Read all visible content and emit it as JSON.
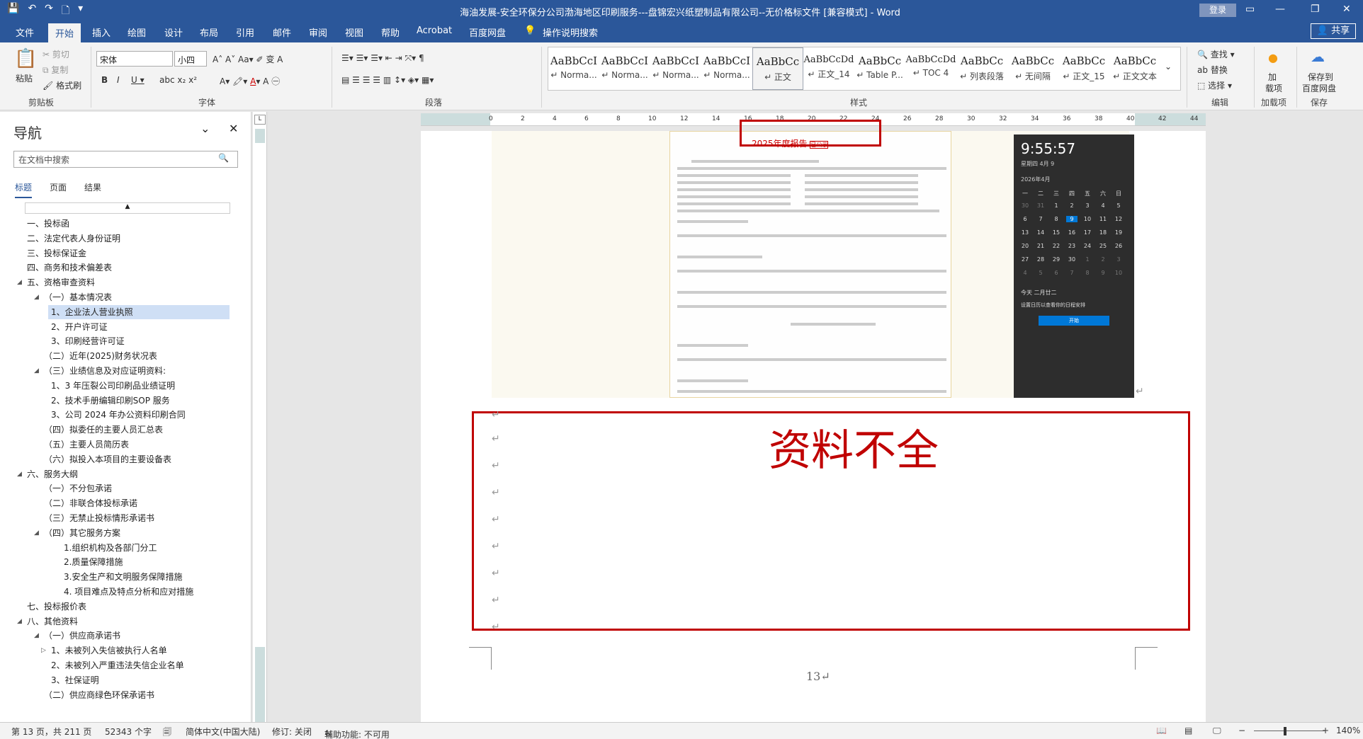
{
  "window": {
    "title": "海油发展-安全环保分公司渤海地区印刷服务---盘锦宏兴纸塑制品有限公司--无价格标文件 [兼容模式]  -  Word",
    "login": "登录"
  },
  "tabs": [
    "文件",
    "开始",
    "插入",
    "绘图",
    "设计",
    "布局",
    "引用",
    "邮件",
    "审阅",
    "视图",
    "帮助",
    "Acrobat",
    "百度网盘"
  ],
  "tell_me": "操作说明搜索",
  "share": "共享",
  "ribbon": {
    "clipboard": {
      "paste": "粘贴",
      "cut": "剪切",
      "copy": "复制",
      "format_painter": "格式刷",
      "label": "剪贴板"
    },
    "font": {
      "name": "宋体",
      "size": "小四",
      "label": "字体"
    },
    "paragraph": {
      "label": "段落"
    },
    "styles": {
      "label": "样式",
      "items": [
        {
          "preview": "AaBbCcI",
          "name": "↵ Norma..."
        },
        {
          "preview": "AaBbCcI",
          "name": "↵ Norma..."
        },
        {
          "preview": "AaBbCcI",
          "name": "↵ Norma..."
        },
        {
          "preview": "AaBbCcI",
          "name": "↵ Norma..."
        },
        {
          "preview": "AaBbCc",
          "name": "↵ 正文"
        },
        {
          "preview": "AaBbCcDd",
          "name": "↵ 正文_14"
        },
        {
          "preview": "AaBbCc",
          "name": "↵ Table P..."
        },
        {
          "preview": "AaBbCcDd",
          "name": "↵ TOC 4"
        },
        {
          "preview": "AaBbCc",
          "name": "↵ 列表段落"
        },
        {
          "preview": "AaBbCc",
          "name": "↵ 无间隔"
        },
        {
          "preview": "AaBbCc",
          "name": "↵ 正文_15"
        },
        {
          "preview": "AaBbCc",
          "name": "↵ 正文文本"
        }
      ]
    },
    "editing": {
      "find": "查找",
      "replace": "替换",
      "select": "选择",
      "label": "编辑"
    },
    "addins": {
      "btn1": "加",
      "btn2": "载项",
      "label": "加载项"
    },
    "save": {
      "btn1": "保存到",
      "btn2": "百度网盘",
      "label": "保存"
    }
  },
  "nav": {
    "title": "导航",
    "search_placeholder": "在文档中搜索",
    "tabs": [
      "标题",
      "页面",
      "结果"
    ],
    "items": [
      {
        "text": "一、投标函",
        "level": 0,
        "caret": ""
      },
      {
        "text": "二、法定代表人身份证明",
        "level": 0,
        "caret": ""
      },
      {
        "text": "三、投标保证金",
        "level": 0,
        "caret": ""
      },
      {
        "text": "四、商务和技术偏差表",
        "level": 0,
        "caret": ""
      },
      {
        "text": "五、资格审查资料",
        "level": 0,
        "caret": "◢"
      },
      {
        "text": "（一）基本情况表",
        "level": 1,
        "caret": "◢"
      },
      {
        "text": "1、企业法人营业执照",
        "level": 2,
        "caret": "",
        "sel": true
      },
      {
        "text": "2、开户许可证",
        "level": 2,
        "caret": ""
      },
      {
        "text": "3、印刷经营许可证",
        "level": 2,
        "caret": ""
      },
      {
        "text": "（二）近年(2025)财务状况表",
        "level": 1,
        "caret": ""
      },
      {
        "text": "（三）业绩信息及对应证明资料:",
        "level": 1,
        "caret": "◢"
      },
      {
        "text": "1、3 年压裂公司印刷品业绩证明",
        "level": 2,
        "caret": ""
      },
      {
        "text": "2、技术手册编辑印刷SOP 服务",
        "level": 2,
        "caret": ""
      },
      {
        "text": "3、公司 2024 年办公资料印刷合同",
        "level": 2,
        "caret": ""
      },
      {
        "text": "（四）拟委任的主要人员汇总表",
        "level": 1,
        "caret": ""
      },
      {
        "text": "（五）主要人员简历表",
        "level": 1,
        "caret": ""
      },
      {
        "text": "（六）拟投入本项目的主要设备表",
        "level": 1,
        "caret": ""
      },
      {
        "text": "六、服务大纲",
        "level": 0,
        "caret": "◢"
      },
      {
        "text": "（一）不分包承诺",
        "level": 1,
        "caret": ""
      },
      {
        "text": "（二）非联合体投标承诺",
        "level": 1,
        "caret": ""
      },
      {
        "text": "（三）无禁止投标情形承诺书",
        "level": 1,
        "caret": ""
      },
      {
        "text": "（四）其它服务方案",
        "level": 1,
        "caret": "◢"
      },
      {
        "text": "1.组织机构及各部门分工",
        "level": 3,
        "caret": ""
      },
      {
        "text": "2.质量保障措施",
        "level": 3,
        "caret": ""
      },
      {
        "text": "3.安全生产和文明服务保障措施",
        "level": 3,
        "caret": ""
      },
      {
        "text": "4. 项目难点及特点分析和应对措施",
        "level": 3,
        "caret": ""
      },
      {
        "text": "七、投标报价表",
        "level": 0,
        "caret": ""
      },
      {
        "text": "八、其他资料",
        "level": 0,
        "caret": "◢"
      },
      {
        "text": "（一）供应商承诺书",
        "level": 1,
        "caret": "◢"
      },
      {
        "text": "1、未被列入失信被执行人名单",
        "level": 2,
        "caret": "▷"
      },
      {
        "text": "2、未被列入严重违法失信企业名单",
        "level": 2,
        "caret": ""
      },
      {
        "text": "3、社保证明",
        "level": 2,
        "caret": ""
      },
      {
        "text": "（二）供应商绿色环保承诺书",
        "level": 1,
        "caret": ""
      }
    ]
  },
  "document": {
    "report_title": "2025年度报告",
    "report_stamp": "已公示",
    "annotation": "资料不全",
    "page_number": "13↵",
    "calendar": {
      "time": "9:55:57",
      "date": "星期四 4月 9",
      "month": "2026年4月",
      "weekdays": [
        "一",
        "二",
        "三",
        "四",
        "五",
        "六",
        "日"
      ],
      "days": [
        [
          "30",
          "31",
          "1",
          "2",
          "3",
          "4",
          "5"
        ],
        [
          "6",
          "7",
          "8",
          "9",
          "10",
          "11",
          "12"
        ],
        [
          "13",
          "14",
          "15",
          "16",
          "17",
          "18",
          "19"
        ],
        [
          "20",
          "21",
          "22",
          "23",
          "24",
          "25",
          "26"
        ],
        [
          "27",
          "28",
          "29",
          "30",
          "1",
          "2",
          "3"
        ],
        [
          "4",
          "5",
          "6",
          "7",
          "8",
          "9",
          "10"
        ]
      ],
      "today_label": "今天 二月廿二",
      "event": "设置日历以查看你的日程安排",
      "button": "开始"
    }
  },
  "status": {
    "page": "第 13 页，共 211 页",
    "words": "52343 个字",
    "language": "简体中文(中国大陆)",
    "track": "修订: 关闭",
    "accessibility": "辅助功能: 不可用",
    "zoom": "140%"
  }
}
